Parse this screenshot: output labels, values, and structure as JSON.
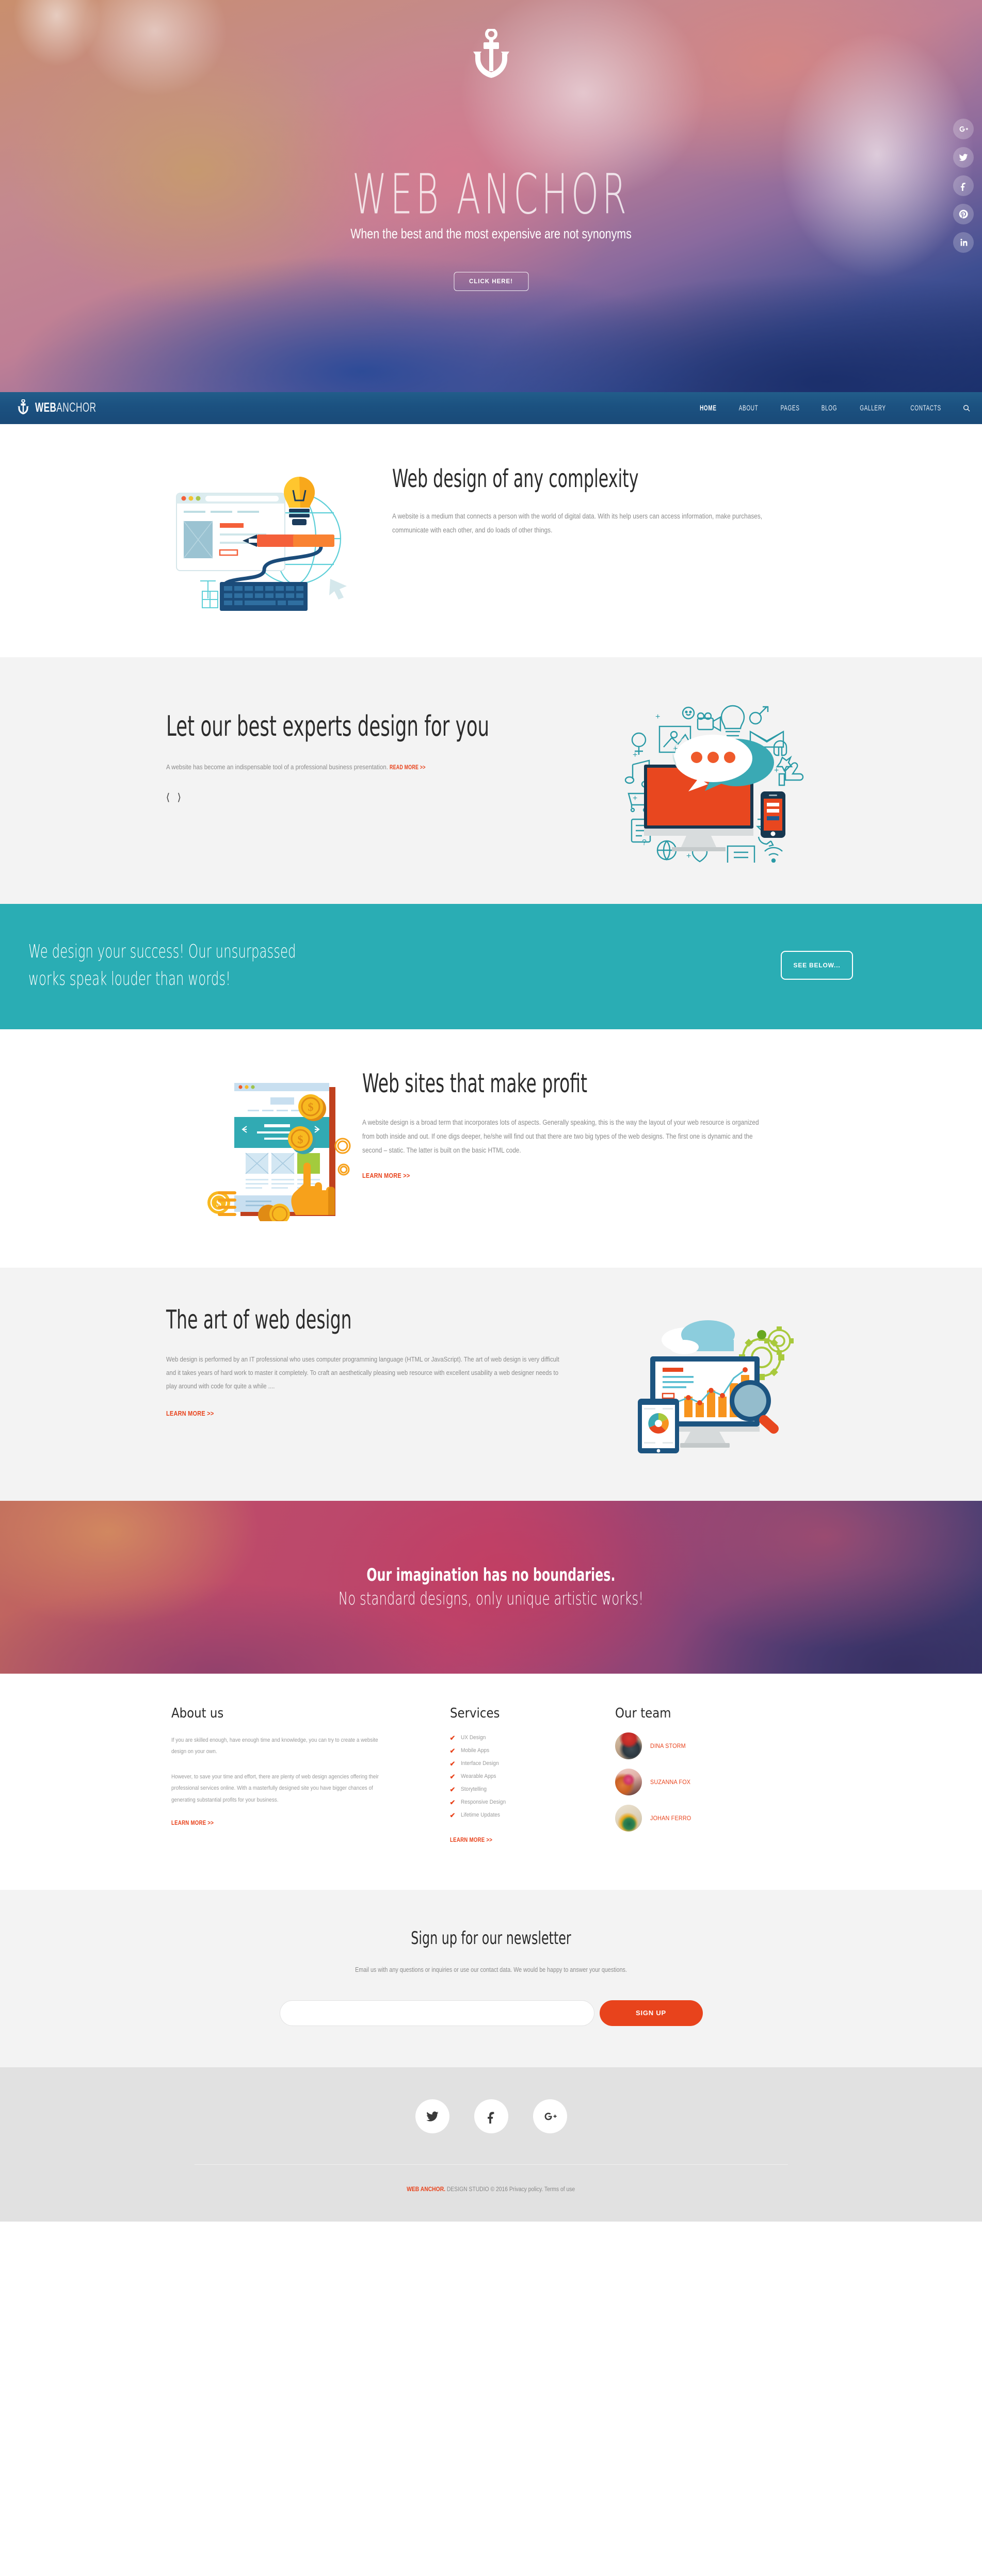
{
  "hero": {
    "logo_icon": "anchor-icon",
    "title_bold": "WEB",
    "title_light": "ANCHOR",
    "subtitle": "When the best and the most expensive are not synonyms",
    "button_label": "CLICK HERE!",
    "social": [
      {
        "icon": "google-plus-icon",
        "name": "Google Plus"
      },
      {
        "icon": "twitter-icon",
        "name": "Twitter"
      },
      {
        "icon": "facebook-icon",
        "name": "Facebook"
      },
      {
        "icon": "pinterest-icon",
        "name": "Pinterest"
      },
      {
        "icon": "linkedin-icon",
        "name": "LinkedIn"
      }
    ]
  },
  "nav": {
    "brand_bold": "WEB",
    "brand_light": "ANCHOR",
    "items": [
      {
        "label": "HOME",
        "active": true
      },
      {
        "label": "ABOUT",
        "active": false
      },
      {
        "label": "PAGES",
        "active": false
      },
      {
        "label": "BLOG",
        "active": false
      },
      {
        "label": "GALLERY",
        "active": false
      },
      {
        "label": "CONTACTS",
        "active": false
      }
    ],
    "search_icon": "search-icon"
  },
  "section_complexity": {
    "heading": "Web design of any complexity",
    "body": "A website is a medium that connects a person with the world of digital data. With its help users can access information, make purchases, communicate with each other, and do loads of other things."
  },
  "section_experts": {
    "heading": "Let our best experts design for you",
    "body": "A website has become an indispensable tool of a professional business presentation.",
    "link": "READ MORE >>",
    "prev_icon": "chevron-left-icon",
    "next_icon": "chevron-right-icon"
  },
  "teal_band": {
    "text": "We design your success! Our unsurpassed works speak louder than words!",
    "button_label": "SEE BELOW...",
    "color": "#2aadb4"
  },
  "section_profit": {
    "heading": "Web sites that make profit",
    "body": "A website design is a broad term that incorporates lots of aspects. Generally speaking, this is the way the layout of your web resource is organized from both inside and out. If one digs deeper, he/she will find out that there are two big types of the web designs. The first one is dynamic and the second – static. The latter is built on the basic HTML code.",
    "link": "LEARN MORE >>"
  },
  "section_art": {
    "heading": "The art of web design",
    "body": "Web design is performed by an IT professional who uses computer programming language (HTML or JavaScript). The art of web design is very difficult and it takes years of hard work to master it completely. To craft an aesthetically pleasing web resource with excellent usability a web designer needs to play around with code for quite a while ....",
    "link": "LEARN MORE >>"
  },
  "imagination_band": {
    "line1": "Our imagination has no boundaries.",
    "line2": "No standard designs, only unique artistic works!"
  },
  "footer_about": {
    "heading": "About us",
    "p1": "If you are skilled enough, have enough time and knowledge, you can try to create a website design on your own.",
    "p2": "However, to save your time and effort, there are plenty of web design agencies offering their professional services online. With a masterfully designed site you have bigger chances of generating substantial profits for your business.",
    "link": "LEARN MORE >>"
  },
  "footer_services": {
    "heading": "Services",
    "items": [
      "UX Design",
      "Mobile Apps",
      "Interface Design",
      "Wearable Apps",
      "Storytelling",
      "Responsive Design",
      "Lifetime Updates"
    ],
    "link": "LEARN MORE >>",
    "check_icon": "check-icon"
  },
  "footer_team": {
    "heading": "Our team",
    "members": [
      {
        "name": "DINA STORM",
        "avatar": "avatar-photographer"
      },
      {
        "name": "SUZANNA FOX",
        "avatar": "avatar-portrait"
      },
      {
        "name": "JOHAN FERRO",
        "avatar": "avatar-flower"
      }
    ]
  },
  "newsletter": {
    "heading": "Sign up for our newsletter",
    "subtext": "Email us with any questions or inquiries or use our contact data. We would be happy to answer your questions.",
    "input_placeholder": "",
    "input_value": "",
    "button_label": "SIGN UP",
    "button_color": "#e8431c"
  },
  "bottom_footer": {
    "social": [
      {
        "icon": "twitter-icon",
        "name": "Twitter"
      },
      {
        "icon": "facebook-icon",
        "name": "Facebook"
      },
      {
        "icon": "google-plus-icon",
        "name": "Google Plus"
      }
    ],
    "copyright_brand": "WEB ANCHOR.",
    "copyright_rest": " DESIGN STUDIO © 2016 Privacy policy. Terms of use"
  },
  "colors": {
    "accent_orange": "#e8431c",
    "teal": "#2aadb4",
    "nav_blue": "#1b5180",
    "grey_bg": "#f3f3f3",
    "footer_grey": "#e1e1e1"
  }
}
